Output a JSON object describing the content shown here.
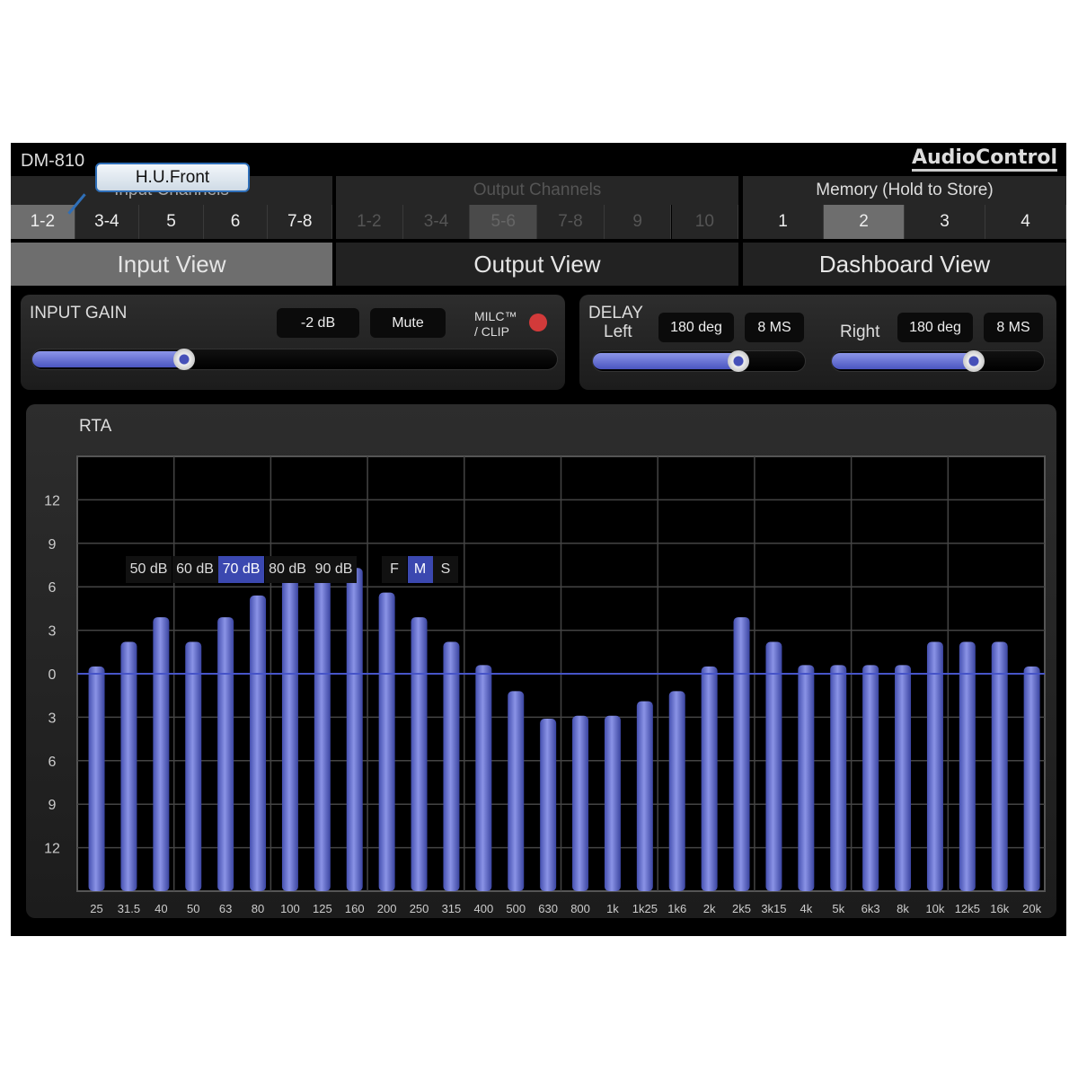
{
  "app": {
    "model": "DM-810",
    "brand": "AudioControl",
    "tooltip": "H.U.Front"
  },
  "input_channels": {
    "label": "Input Channels",
    "items": [
      "1-2",
      "3-4",
      "5",
      "6",
      "7-8"
    ],
    "selected": "1-2"
  },
  "output_channels": {
    "label": "Output Channels",
    "items": [
      "1-2",
      "3-4",
      "5-6",
      "7-8",
      "9",
      "10"
    ],
    "selected": "5-6"
  },
  "memory": {
    "label": "Memory (Hold to Store)",
    "items": [
      "1",
      "2",
      "3",
      "4"
    ],
    "selected": "2"
  },
  "views": {
    "input": "Input View",
    "output": "Output View",
    "dashboard": "Dashboard View",
    "selected": "Input View"
  },
  "input_gain": {
    "label": "INPUT GAIN",
    "value": "-2 dB",
    "mute": "Mute",
    "milc": "MILC™",
    "clip": "/ CLIP",
    "level": 0.28,
    "clip_color": "#d23a3a"
  },
  "delay": {
    "label": "DELAY",
    "left": {
      "label": "Left",
      "phase": "180 deg",
      "time": "8 MS",
      "level": 0.7
    },
    "right": {
      "label": "Right",
      "phase": "180 deg",
      "time": "8 MS",
      "level": 0.68
    }
  },
  "rta": {
    "label": "RTA",
    "ranges": [
      "50 dB",
      "60 dB",
      "70 dB",
      "80 dB",
      "90 dB"
    ],
    "selected_range": "70 dB",
    "speeds": [
      "F",
      "M",
      "S"
    ],
    "selected_speed": "M",
    "accent": "#3b48b0"
  },
  "chart_data": {
    "type": "bar",
    "ylim": [
      -15,
      15
    ],
    "grid": true,
    "yticks": [
      12,
      9,
      6,
      3,
      0,
      -3,
      -6,
      -9,
      -12
    ],
    "ytick_labels": [
      "12",
      "9",
      "6",
      "3",
      "0",
      "3",
      "6",
      "9",
      "12"
    ],
    "categories": [
      "25",
      "31.5",
      "40",
      "50",
      "63",
      "80",
      "100",
      "125",
      "160",
      "200",
      "250",
      "315",
      "400",
      "500",
      "630",
      "800",
      "1k",
      "1k25",
      "1k6",
      "2k",
      "2k5",
      "3k15",
      "4k",
      "5k",
      "6k3",
      "8k",
      "10k",
      "12k5",
      "16k",
      "20k"
    ],
    "values": [
      0.5,
      2.2,
      3.9,
      2.2,
      3.9,
      5.4,
      7.3,
      7.2,
      7.3,
      5.6,
      3.9,
      2.2,
      0.6,
      -1.2,
      -3.1,
      -2.9,
      -2.9,
      -1.9,
      -1.2,
      0.5,
      3.9,
      2.2,
      0.6,
      0.6,
      0.6,
      0.6,
      2.2,
      2.2,
      2.2,
      0.5
    ],
    "bar_color": "#6670d0"
  }
}
